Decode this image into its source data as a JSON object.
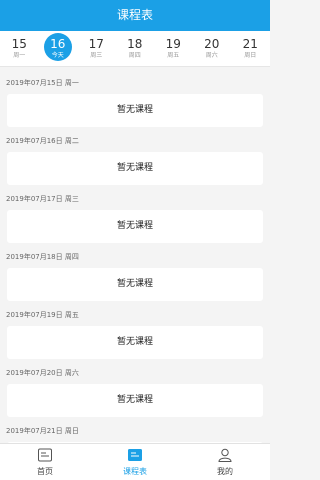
{
  "header": {
    "title": "课程表"
  },
  "dates": [
    {
      "num": "15",
      "weekday": "周一",
      "active": false
    },
    {
      "num": "16",
      "weekday": "今天",
      "active": true
    },
    {
      "num": "17",
      "weekday": "周三",
      "active": false
    },
    {
      "num": "18",
      "weekday": "周四",
      "active": false
    },
    {
      "num": "19",
      "weekday": "周五",
      "active": false
    },
    {
      "num": "20",
      "weekday": "周六",
      "active": false
    },
    {
      "num": "21",
      "weekday": "周日",
      "active": false
    }
  ],
  "schedule": [
    {
      "date": "2019年07月15日 周一",
      "course": "暂无课程"
    },
    {
      "date": "2019年07月16日 周二",
      "course": "暂无课程"
    },
    {
      "date": "2019年07月17日 周三",
      "course": "暂无课程"
    },
    {
      "date": "2019年07月18日 周四",
      "course": "暂无课程"
    },
    {
      "date": "2019年07月19日 周五",
      "course": "暂无课程"
    },
    {
      "date": "2019年07月20日 周六",
      "course": "暂无课程"
    },
    {
      "date": "2019年07月21日 周日",
      "course": ""
    }
  ],
  "tabs": [
    {
      "label": "首页",
      "icon": "home-icon",
      "active": false
    },
    {
      "label": "课程表",
      "icon": "schedule-icon",
      "active": true
    },
    {
      "label": "我的",
      "icon": "profile-icon",
      "active": false
    }
  ],
  "colors": {
    "accent": "#1ba0e6",
    "background": "#f4f4f4",
    "card": "#ffffff"
  }
}
